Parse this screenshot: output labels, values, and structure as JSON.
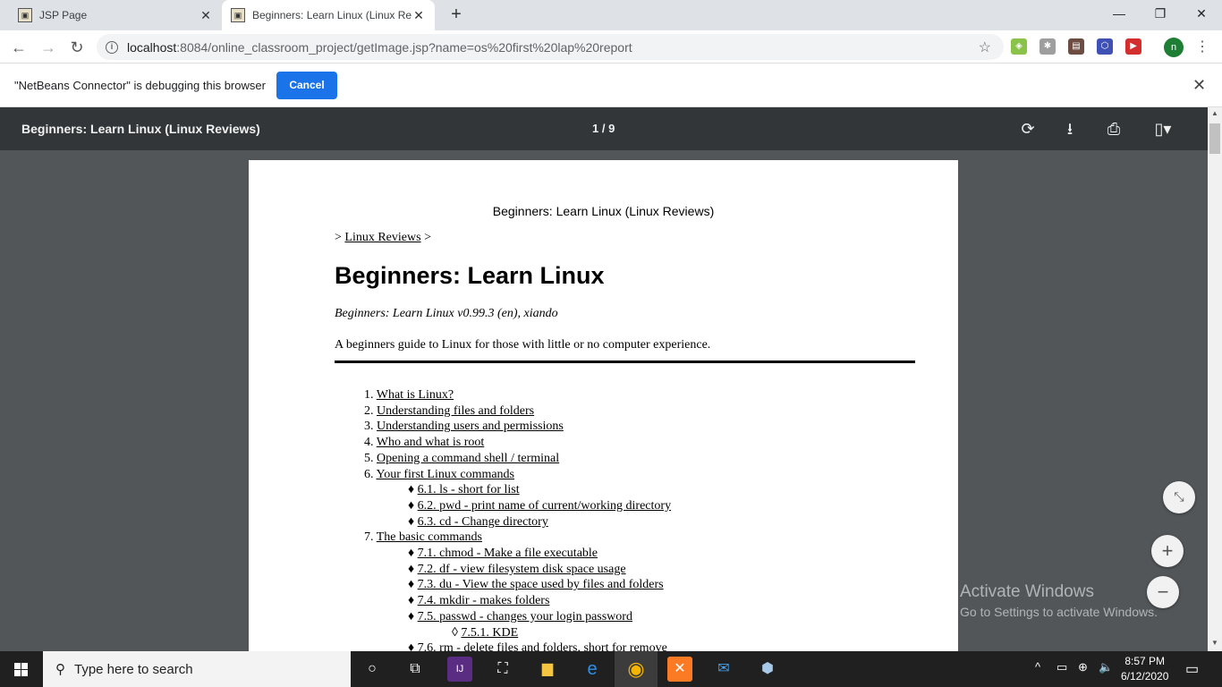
{
  "browser": {
    "tabs": [
      {
        "title": "JSP Page"
      },
      {
        "title": "Beginners: Learn Linux (Linux Rev"
      }
    ],
    "new_tab": "+",
    "address": {
      "host": "localhost",
      "path": ":8084/online_classroom_project/getImage.jsp?name=os%20first%20lap%20report"
    },
    "avatar_letter": "n"
  },
  "infobar": {
    "message": "\"NetBeans Connector\" is debugging this browser",
    "cancel_label": "Cancel"
  },
  "pdf": {
    "title": "Beginners: Learn Linux (Linux Reviews)",
    "page_indicator": "1 / 9"
  },
  "document": {
    "running_head": "Beginners: Learn Linux (Linux Reviews)",
    "breadcrumb_prefix": ">",
    "breadcrumb_link": "Linux Reviews",
    "breadcrumb_suffix": ">",
    "heading": "Beginners: Learn Linux",
    "byline": "Beginners: Learn Linux v0.99.3 (en), xiando",
    "intro": "A beginners guide to Linux for those with little or no computer experience.",
    "toc": [
      {
        "marker": "1.",
        "text": "What is Linux?",
        "level": 1
      },
      {
        "marker": "2.",
        "text": "Understanding files and folders",
        "level": 1
      },
      {
        "marker": "3.",
        "text": "Understanding users and permissions",
        "level": 1
      },
      {
        "marker": "4.",
        "text": "Who and what is root",
        "level": 1
      },
      {
        "marker": "5.",
        "text": "Opening a command shell / terminal",
        "level": 1
      },
      {
        "marker": "6.",
        "text": "Your first Linux commands",
        "level": 1
      },
      {
        "marker": "♦",
        "text": "6.1. ls - short for list",
        "level": 2
      },
      {
        "marker": "♦",
        "text": "6.2. pwd - print name of current/working directory",
        "level": 2
      },
      {
        "marker": "♦",
        "text": "6.3. cd - Change directory",
        "level": 2
      },
      {
        "marker": "7.",
        "text": "The basic commands",
        "level": 1
      },
      {
        "marker": "♦",
        "text": "7.1. chmod - Make a file executable",
        "level": 2
      },
      {
        "marker": "♦",
        "text": "7.2. df - view filesystem disk space usage",
        "level": 2
      },
      {
        "marker": "♦",
        "text": "7.3. du - View the space used by files and folders",
        "level": 2
      },
      {
        "marker": "♦",
        "text": "7.4. mkdir - makes folders",
        "level": 2
      },
      {
        "marker": "♦",
        "text": "7.5. passwd - changes your login password",
        "level": 2
      },
      {
        "marker": "◊",
        "text": "7.5.1. KDE",
        "level": 3
      },
      {
        "marker": "♦",
        "text": "7.6. rm - delete files and folders, short for remove",
        "level": 2
      }
    ]
  },
  "watermark": {
    "line1": "Activate Windows",
    "line2": "Go to Settings to activate Windows."
  },
  "taskbar": {
    "search_placeholder": "Type here to search",
    "time": "8:57 PM",
    "date": "6/12/2020"
  }
}
